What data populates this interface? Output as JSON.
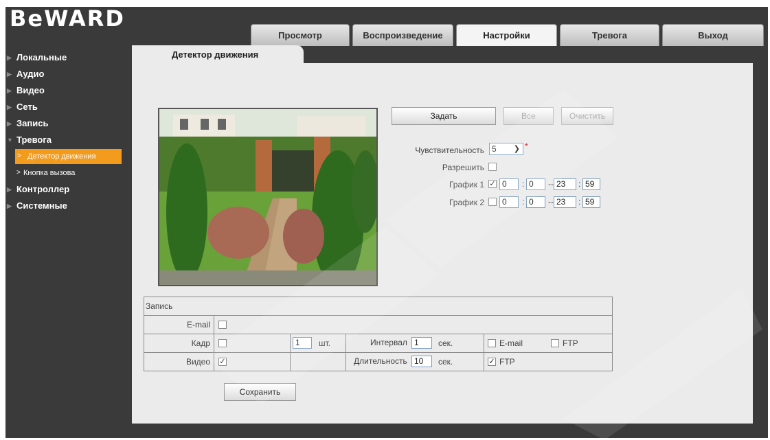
{
  "app": {
    "logo": "BeWARD"
  },
  "tabs": [
    {
      "label": "Просмотр",
      "active": false
    },
    {
      "label": "Воспроизведение",
      "active": false
    },
    {
      "label": "Настройки",
      "active": true
    },
    {
      "label": "Тревога",
      "active": false
    },
    {
      "label": "Выход",
      "active": false
    }
  ],
  "sidebar": {
    "items": [
      {
        "label": "Локальные"
      },
      {
        "label": "Аудио"
      },
      {
        "label": "Видео"
      },
      {
        "label": "Сеть"
      },
      {
        "label": "Запись"
      },
      {
        "label": "Тревога",
        "expanded": true
      },
      {
        "label": "Детектор движения",
        "sub": true,
        "active": true
      },
      {
        "label": "Кнопка вызова",
        "sub": true
      },
      {
        "label": "Контроллер"
      },
      {
        "label": "Системные"
      }
    ]
  },
  "content_tab": {
    "title": "Детектор движения"
  },
  "buttons": {
    "set": "Задать",
    "all": "Все",
    "clear": "Очистить",
    "save": "Сохранить"
  },
  "motion": {
    "sensitivity_label": "Чувствительность",
    "sensitivity_value": "5",
    "enable_label": "Разрешить",
    "enable_checked": false,
    "schedule1": {
      "label": "График 1",
      "checked": true,
      "h1": "0",
      "m1": "0",
      "h2": "23",
      "m2": "59"
    },
    "schedule2": {
      "label": "График 2",
      "checked": false,
      "h1": "0",
      "m1": "0",
      "h2": "23",
      "m2": "59"
    },
    "time_sep": ":",
    "range_sep": "--"
  },
  "record": {
    "header": "Запись",
    "email_label": "E-mail",
    "frame_label": "Кадр",
    "frame_count": "1",
    "frame_unit": "шт.",
    "interval_label": "Интервал",
    "interval_value": "1",
    "interval_unit": "сек.",
    "frame_email": "E-mail",
    "frame_ftp": "FTP",
    "video_label": "Видео",
    "duration_label": "Длительность",
    "duration_value": "10",
    "duration_unit": "сек.",
    "video_ftp": "FTP",
    "checks": {
      "email": false,
      "frame": false,
      "frame_email": false,
      "frame_ftp": false,
      "video": true,
      "video_ftp": true
    }
  },
  "colors": {
    "accent": "#f29b1d",
    "background": "#3a3a3a",
    "panel": "#ebebeb"
  }
}
